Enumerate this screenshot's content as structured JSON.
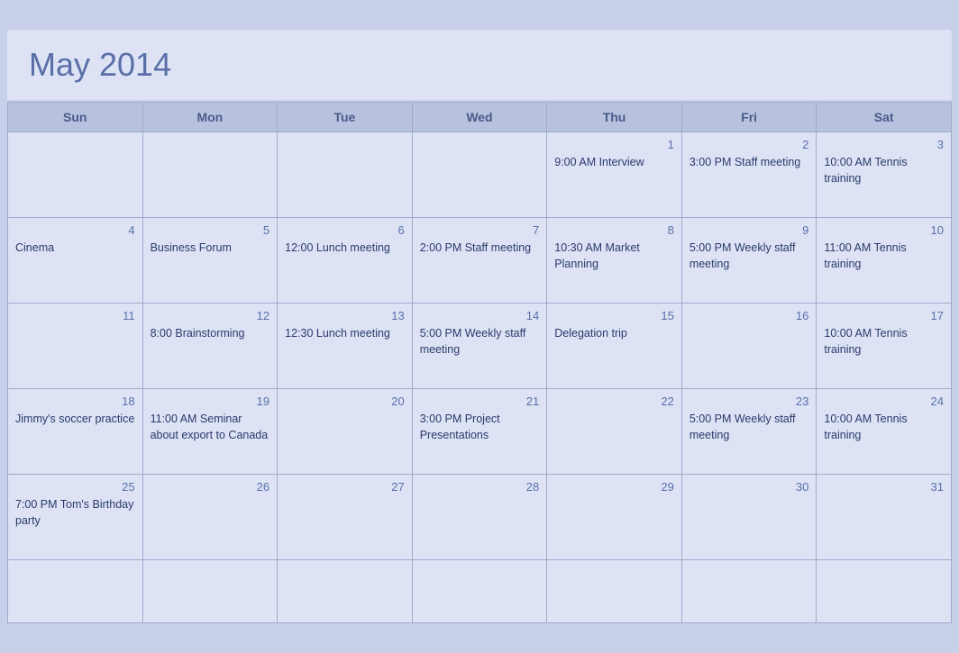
{
  "title": "May 2014",
  "days_of_week": [
    "Sun",
    "Mon",
    "Tue",
    "Wed",
    "Thu",
    "Fri",
    "Sat"
  ],
  "weeks": [
    [
      {
        "day": "",
        "event": ""
      },
      {
        "day": "",
        "event": ""
      },
      {
        "day": "",
        "event": ""
      },
      {
        "day": "",
        "event": ""
      },
      {
        "day": "1",
        "event": "9:00 AM Interview"
      },
      {
        "day": "2",
        "event": "3:00 PM Staff meeting"
      },
      {
        "day": "3",
        "event": "10:00 AM Tennis training"
      }
    ],
    [
      {
        "day": "4",
        "event": "Cinema"
      },
      {
        "day": "5",
        "event": "Business Forum"
      },
      {
        "day": "6",
        "event": "12:00 Lunch meeting"
      },
      {
        "day": "7",
        "event": "2:00 PM Staff meeting"
      },
      {
        "day": "8",
        "event": "10:30 AM Market Planning"
      },
      {
        "day": "9",
        "event": "5:00 PM Weekly staff meeting"
      },
      {
        "day": "10",
        "event": "11:00 AM Tennis training"
      }
    ],
    [
      {
        "day": "11",
        "event": ""
      },
      {
        "day": "12",
        "event": "8:00 Brainstorming"
      },
      {
        "day": "13",
        "event": "12:30 Lunch meeting"
      },
      {
        "day": "14",
        "event": "5:00 PM Weekly staff meeting"
      },
      {
        "day": "15",
        "event": "Delegation trip"
      },
      {
        "day": "16",
        "event": ""
      },
      {
        "day": "17",
        "event": "10:00 AM Tennis training"
      }
    ],
    [
      {
        "day": "18",
        "event": "Jimmy's soccer practice"
      },
      {
        "day": "19",
        "event": "11:00 AM Seminar about export to Canada"
      },
      {
        "day": "20",
        "event": ""
      },
      {
        "day": "21",
        "event": "3:00 PM Project Presentations"
      },
      {
        "day": "22",
        "event": ""
      },
      {
        "day": "23",
        "event": "5:00 PM Weekly staff meeting"
      },
      {
        "day": "24",
        "event": "10:00 AM Tennis training"
      }
    ],
    [
      {
        "day": "25",
        "event": "7:00 PM Tom's Birthday party"
      },
      {
        "day": "26",
        "event": ""
      },
      {
        "day": "27",
        "event": ""
      },
      {
        "day": "28",
        "event": ""
      },
      {
        "day": "29",
        "event": ""
      },
      {
        "day": "30",
        "event": ""
      },
      {
        "day": "31",
        "event": ""
      }
    ],
    [
      {
        "day": "",
        "event": ""
      },
      {
        "day": "",
        "event": ""
      },
      {
        "day": "",
        "event": ""
      },
      {
        "day": "",
        "event": ""
      },
      {
        "day": "",
        "event": ""
      },
      {
        "day": "",
        "event": ""
      },
      {
        "day": "",
        "event": ""
      }
    ]
  ]
}
